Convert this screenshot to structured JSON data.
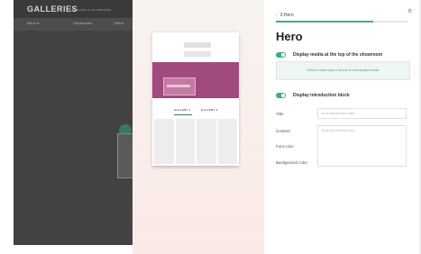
{
  "left_app": {
    "brand": "GALLERIES",
    "brand_sub": "TIMELINES & SHOWROOMS",
    "nav": [
      "Menu ▾",
      "Showrooms",
      "Offers"
    ]
  },
  "preview": {
    "tabs": [
      "GALLERY 1",
      "GALLERY 2"
    ],
    "hero_color": "#a04a7e"
  },
  "panel": {
    "back_label": "3.Hero",
    "progress_fraction": 0.74,
    "title": "Hero",
    "accent_color": "#3fae7c",
    "toggle_media": {
      "label": "Display media at the top of the showroom",
      "on": true
    },
    "media_hint": "Select a video loop or picture in a landscape format",
    "toggle_intro": {
      "label": "Display introduction block",
      "on": true
    },
    "fields": {
      "title_label": "Title",
      "title_placeholder": "Your introduction title",
      "content_label": "Content",
      "content_placeholder": "Your introduction text",
      "font_color_label": "Font color",
      "background_color_label": "Background color"
    }
  }
}
